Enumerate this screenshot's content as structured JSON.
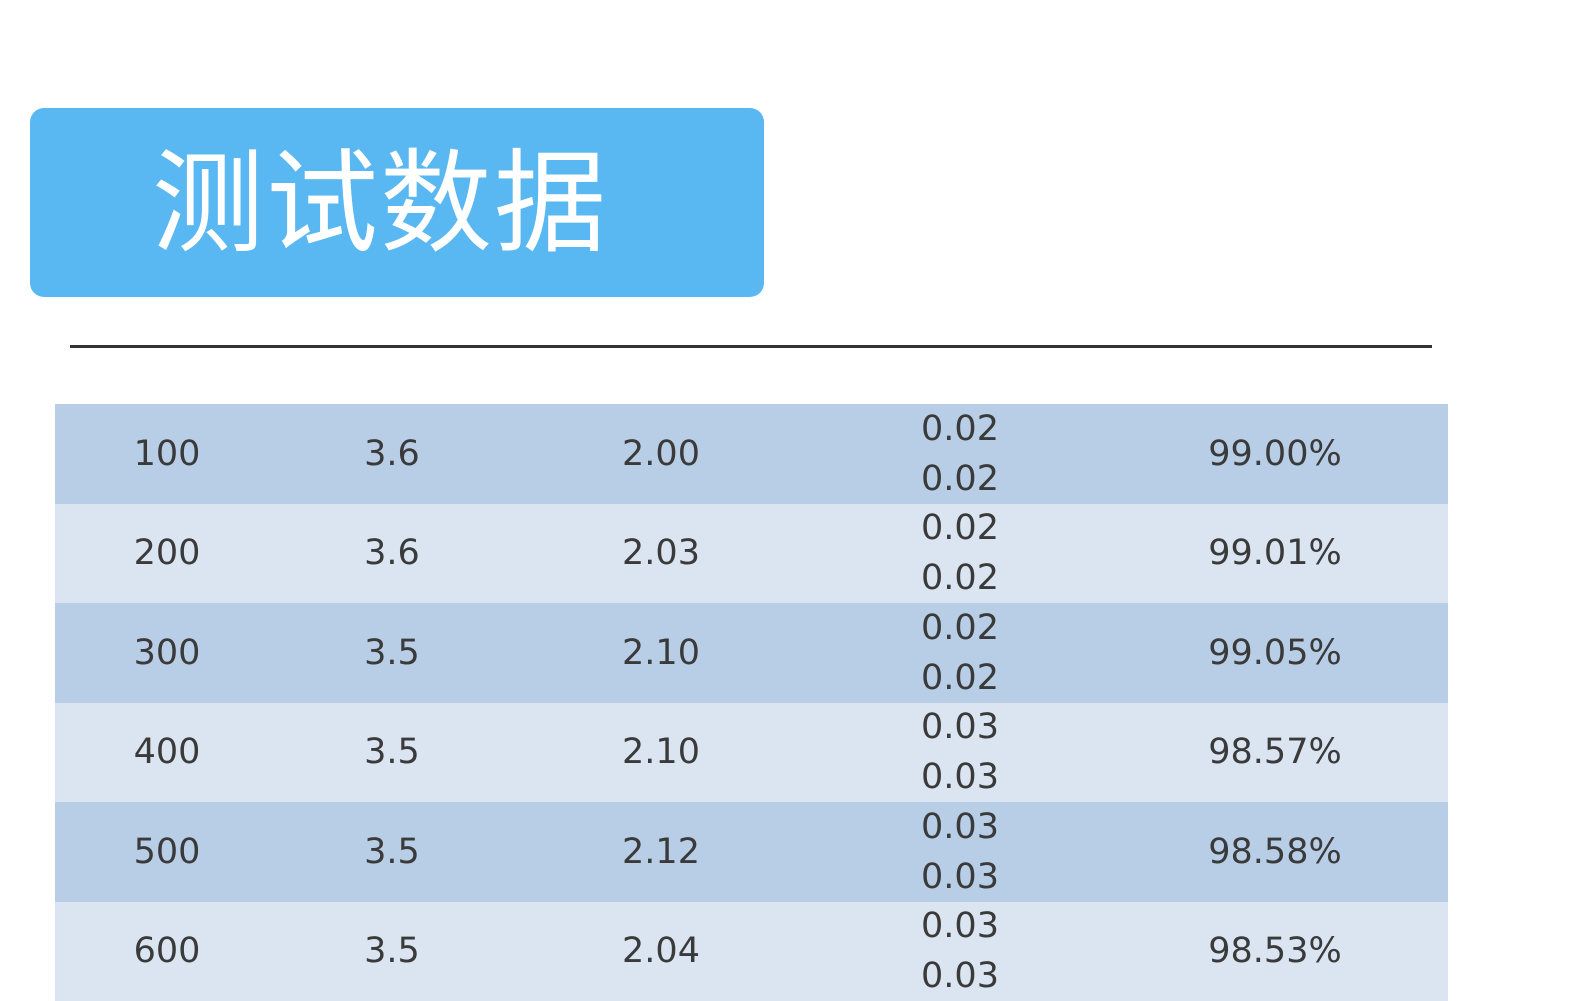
{
  "title": "测试数据",
  "colors": {
    "banner": "#59b7f2",
    "row_dark": "#b8cde6",
    "row_light": "#dbe5f2",
    "text": "#3a3a3a",
    "divider": "#333333"
  },
  "rows": [
    {
      "col1": "100",
      "col2": "3.6",
      "col3": "2.00",
      "col4a": "0.02",
      "col4b": "0.02",
      "col5": "99.00%"
    },
    {
      "col1": "200",
      "col2": "3.6",
      "col3": "2.03",
      "col4a": "0.02",
      "col4b": "0.02",
      "col5": "99.01%"
    },
    {
      "col1": "300",
      "col2": "3.5",
      "col3": "2.10",
      "col4a": "0.02",
      "col4b": "0.02",
      "col5": "99.05%"
    },
    {
      "col1": "400",
      "col2": "3.5",
      "col3": "2.10",
      "col4a": "0.03",
      "col4b": "0.03",
      "col5": "98.57%"
    },
    {
      "col1": "500",
      "col2": "3.5",
      "col3": "2.12",
      "col4a": "0.03",
      "col4b": "0.03",
      "col5": "98.58%"
    },
    {
      "col1": "600",
      "col2": "3.5",
      "col3": "2.04",
      "col4a": "0.03",
      "col4b": "0.03",
      "col5": "98.53%"
    }
  ]
}
